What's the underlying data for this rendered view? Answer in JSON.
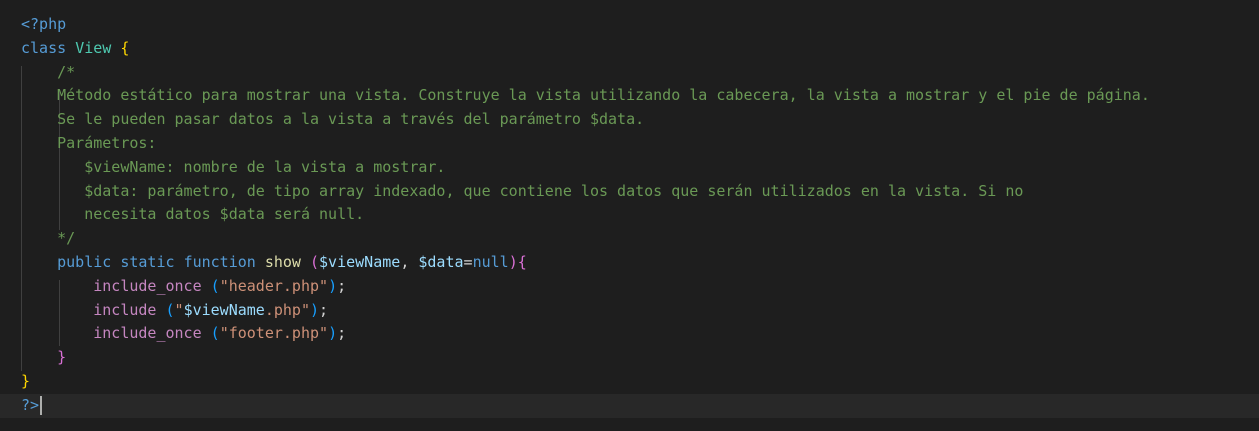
{
  "editor": {
    "language": "php",
    "theme_colors": {
      "background": "#1e1e1e",
      "keyword": "#569cd6",
      "class_name": "#4ec9b0",
      "function": "#dcdcaa",
      "variable": "#9cdcfe",
      "string": "#ce9178",
      "comment": "#6a9955",
      "bracket_level1": "#ffd700",
      "bracket_level2": "#da70d6",
      "bracket_level3": "#179fff"
    },
    "tokens": {
      "php_open": "<?php",
      "class_kw": "class",
      "class_name": "View",
      "brace_open": "{",
      "comment_open": "/*",
      "comment_l1": "Método estático para mostrar una vista. Construye la vista utilizando la cabecera, la vista a mostrar y el pie de página.",
      "comment_l2": "Se le pueden pasar datos a la vista a través del parámetro $data.",
      "comment_l3": "Parámetros:",
      "comment_l4": "$viewName: nombre de la vista a mostrar.",
      "comment_l5": "$data: parámetro, de tipo array indexado, que contiene los datos que serán utilizados en la vista. Si no",
      "comment_l6": "necesita datos $data será null.",
      "comment_close": "*/",
      "public_kw": "public",
      "static_kw": "static",
      "function_kw": "function",
      "fn_name": "show",
      "paren_open": "(",
      "param1": "$viewName",
      "comma": ",",
      "param2": "$data",
      "equals": "=",
      "null_kw": "null",
      "paren_close": ")",
      "method_brace_open": "{",
      "include_once_kw": "include_once",
      "include_kw": "include",
      "str_header": "\"header.php\"",
      "str_quote": "\"",
      "str_var": "$viewName",
      "str_ext": ".php\"",
      "str_footer": "\"footer.php\"",
      "semicolon": ";",
      "method_brace_close": "}",
      "class_brace_close": "}",
      "php_close": "?>"
    }
  }
}
